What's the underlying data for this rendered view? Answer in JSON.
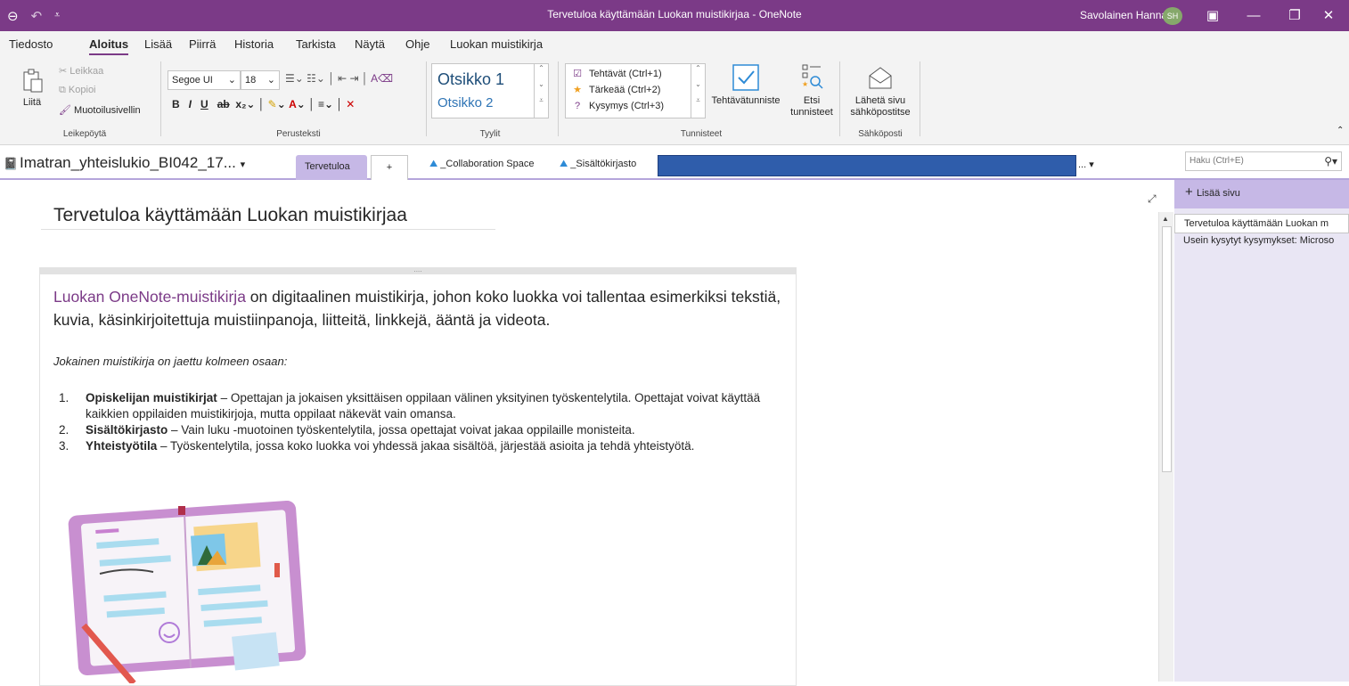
{
  "titlebar": {
    "title": "Tervetuloa käyttämään Luokan muistikirjaa  -  OneNote",
    "user": "Savolainen Hanna",
    "avatar": "SH",
    "back_icon": "back-icon",
    "undo_icon": "undo-icon"
  },
  "menu": {
    "tabs": [
      "Tiedosto",
      "Aloitus",
      "Lisää",
      "Piirrä",
      "Historia",
      "Tarkista",
      "Näytä",
      "Ohje",
      "Luokan muistikirja"
    ],
    "active": "Aloitus"
  },
  "ribbon": {
    "clipboard": {
      "paste": "Liitä",
      "cut": "Leikkaa",
      "copy": "Kopioi",
      "format_painter": "Muotoilusivellin",
      "label": "Leikepöytä"
    },
    "basic_text": {
      "font": "Segoe UI",
      "size": "18",
      "label": "Perusteksti"
    },
    "styles": {
      "heading1": "Otsikko 1",
      "heading2": "Otsikko 2",
      "label": "Tyylit"
    },
    "tags": {
      "items": [
        "Tehtävät (Ctrl+1)",
        "Tärkeää (Ctrl+2)",
        "Kysymys (Ctrl+3)"
      ],
      "todo_tag": "Tehtävätunniste",
      "find_tags_1": "Etsi",
      "find_tags_2": "tunnisteet",
      "label": "Tunnisteet"
    },
    "email": {
      "send_1": "Lähetä sivu",
      "send_2": "sähköpostitse",
      "label": "Sähköposti"
    }
  },
  "notebook": {
    "name": "Imatran_yhteislukio_BI042_17...",
    "active_section": "Tervetuloa",
    "add_tab": "+",
    "group1": "_Collaboration Space",
    "group2": "_Sisältökirjasto",
    "more": "...",
    "search_placeholder": "Haku (Ctrl+E)"
  },
  "page": {
    "title": "Tervetuloa käyttämään Luokan muistikirjaa",
    "handle": "....",
    "intro_link": "Luokan OneNote-muistikirja",
    "intro_rest": " on digitaalinen muistikirja, johon koko luokka voi tallentaa esimerkiksi tekstiä, kuvia, käsinkirjoitettuja muistiinpanoja, liitteitä, linkkejä, ääntä ja videota.",
    "italic": "Jokainen muistikirja on jaettu kolmeen osaan:",
    "list": [
      {
        "num": "1.",
        "bold": "Opiskelijan muistikirjat",
        "text": " – Opettajan ja jokaisen yksittäisen oppilaan välinen yksityinen työskentelytila. Opettajat voivat käyttää kaikkien oppilaiden muistikirjoja, mutta oppilaat näkevät vain omansa."
      },
      {
        "num": "2.",
        "bold": "Sisältökirjasto",
        "text": " – Vain luku -muotoinen työskentelytila, jossa opettajat voivat jakaa oppilaille monisteita."
      },
      {
        "num": "3.",
        "bold": "Yhteistyötila",
        "text": " – Työskentelytila, jossa koko luokka voi yhdessä jakaa sisältöä, järjestää asioita ja tehdä yhteistyötä."
      }
    ]
  },
  "pagelist": {
    "add": "Lisää sivu",
    "pages": [
      "Tervetuloa käyttämään Luokan m",
      "Usein kysytyt kysymykset: Microso"
    ]
  }
}
